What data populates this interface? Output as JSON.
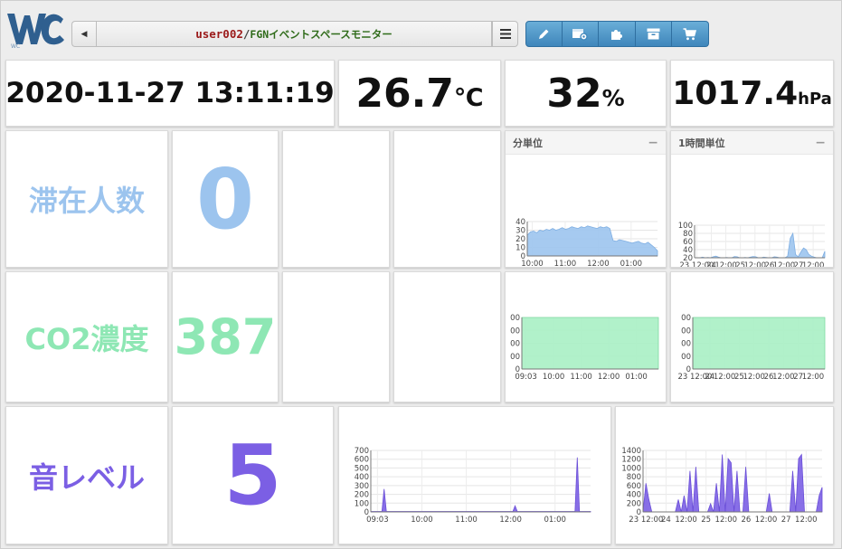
{
  "header": {
    "logo_text": "WC",
    "user": "user002",
    "separator": "/",
    "board_name": "FGNイベントスペースモニター",
    "toolbar_icons": [
      "pencil-icon",
      "calendar-settings-icon",
      "puzzle-icon",
      "archive-icon",
      "cart-icon"
    ]
  },
  "readings": {
    "datetime": "2020-11-27 13:11:19",
    "temperature": {
      "value": "26.7",
      "unit": "℃"
    },
    "humidity": {
      "value": "32",
      "unit": "%"
    },
    "pressure": {
      "value": "1017.4",
      "unit": "hPa"
    }
  },
  "metrics": {
    "occupancy": {
      "label": "滞在人数",
      "value": "0",
      "color": "#9cc4ee"
    },
    "co2": {
      "label": "CO2濃度",
      "value": "387",
      "color": "#8ee7b4"
    },
    "sound": {
      "label": "音レベル",
      "value": "5",
      "color": "#7b5fe4"
    }
  },
  "panels": {
    "minute": {
      "title": "分単位",
      "collapse": "−"
    },
    "hour": {
      "title": "1時間単位",
      "collapse": "−"
    }
  },
  "charts": {
    "occ_minute": {
      "type": "area",
      "color": "#9cc4ee",
      "stroke": "#7eaee2",
      "ylim": [
        0,
        40
      ],
      "yticks": [
        "0",
        "10",
        "20",
        "30",
        "40"
      ],
      "xticks": [
        "10:00",
        "11:00",
        "12:00",
        "01:00"
      ],
      "values": [
        24,
        28,
        29,
        27,
        30,
        29,
        31,
        30,
        32,
        30,
        31,
        33,
        31,
        32,
        34,
        33,
        32,
        34,
        33,
        35,
        34,
        33,
        32,
        34,
        33,
        34,
        32,
        18,
        17,
        19,
        18,
        17,
        16,
        15,
        16,
        17,
        15,
        14,
        16,
        13,
        10,
        6
      ]
    },
    "occ_hour": {
      "type": "area",
      "color": "#9cc4ee",
      "stroke": "#7eaee2",
      "ylim": [
        0,
        100
      ],
      "yticks": [
        "20",
        "40",
        "60",
        "80",
        "100"
      ],
      "xticks": [
        "23 12:00",
        "24",
        "12:00",
        "25",
        "12:00",
        "26",
        "12:00",
        "27",
        "12:00"
      ],
      "values": [
        0,
        0,
        0,
        2,
        0,
        1,
        0,
        3,
        5,
        2,
        0,
        0,
        1,
        0,
        0,
        4,
        3,
        0,
        0,
        1,
        0,
        2,
        4,
        3,
        0,
        0,
        2,
        1,
        0,
        0,
        3,
        2,
        0,
        0,
        0,
        5,
        60,
        75,
        10,
        3,
        18,
        30,
        25,
        10,
        5,
        2,
        0,
        0,
        0,
        20
      ]
    },
    "co2_minute": {
      "type": "area",
      "color": "#a9efc4",
      "stroke": "#7fd9a3",
      "yticks": [
        "0",
        "00",
        "00",
        "00",
        "00"
      ],
      "xticks": [
        "09:03",
        "10:00",
        "11:00",
        "12:00",
        "01:00"
      ],
      "values": [
        387,
        387
      ]
    },
    "co2_hour": {
      "type": "area",
      "color": "#a9efc4",
      "stroke": "#7fd9a3",
      "yticks": [
        "0",
        "00",
        "00",
        "00",
        "00"
      ],
      "xticks": [
        "23 12:00",
        "24",
        "12:00",
        "25",
        "12:00",
        "26",
        "12:00",
        "27",
        "12:00"
      ],
      "values": [
        387,
        387
      ]
    },
    "sound_minute": {
      "type": "area",
      "color": "#7b5fe4",
      "stroke": "#6a4ed8",
      "ylim": [
        0,
        700
      ],
      "yticks": [
        "0",
        "100",
        "200",
        "300",
        "400",
        "500",
        "600",
        "700"
      ],
      "xticks": [
        "09:03",
        "10:00",
        "11:00",
        "12:00",
        "01:00"
      ],
      "values": [
        5,
        5,
        5,
        5,
        5,
        5,
        260,
        5,
        5,
        5,
        5,
        5,
        5,
        5,
        5,
        5,
        5,
        5,
        5,
        5,
        5,
        5,
        5,
        5,
        5,
        5,
        5,
        5,
        5,
        5,
        5,
        5,
        5,
        5,
        5,
        5,
        5,
        5,
        5,
        5,
        5,
        5,
        5,
        5,
        5,
        5,
        5,
        5,
        5,
        5,
        5,
        5,
        5,
        5,
        5,
        5,
        5,
        5,
        5,
        5,
        5,
        5,
        5,
        5,
        5,
        70,
        5,
        5,
        5,
        5,
        5,
        5,
        5,
        5,
        5,
        5,
        5,
        5,
        5,
        5,
        5,
        5,
        5,
        5,
        5,
        5,
        5,
        5,
        5,
        5,
        5,
        5,
        5,
        620,
        5,
        5,
        5,
        5,
        5,
        5
      ]
    },
    "sound_hour": {
      "type": "area",
      "color": "#7b5fe4",
      "stroke": "#6a4ed8",
      "ylim": [
        0,
        1500
      ],
      "yticks": [
        "0",
        "200",
        "400",
        "600",
        "800",
        "1000",
        "1200",
        "1400"
      ],
      "xticks": [
        "23 12:00",
        "24",
        "12:00",
        "25",
        "12:00",
        "26",
        "12:00",
        "27",
        "12:00"
      ],
      "values": [
        0,
        700,
        300,
        0,
        0,
        0,
        0,
        0,
        0,
        0,
        0,
        0,
        300,
        0,
        400,
        0,
        1000,
        0,
        1100,
        0,
        0,
        0,
        0,
        200,
        0,
        700,
        0,
        1400,
        0,
        1300,
        1200,
        0,
        1000,
        0,
        0,
        1100,
        0,
        0,
        0,
        0,
        0,
        0,
        0,
        450,
        0,
        0,
        0,
        0,
        0,
        0,
        0,
        1000,
        0,
        1300,
        1400,
        0,
        0,
        0,
        0,
        0,
        400,
        600
      ]
    }
  }
}
